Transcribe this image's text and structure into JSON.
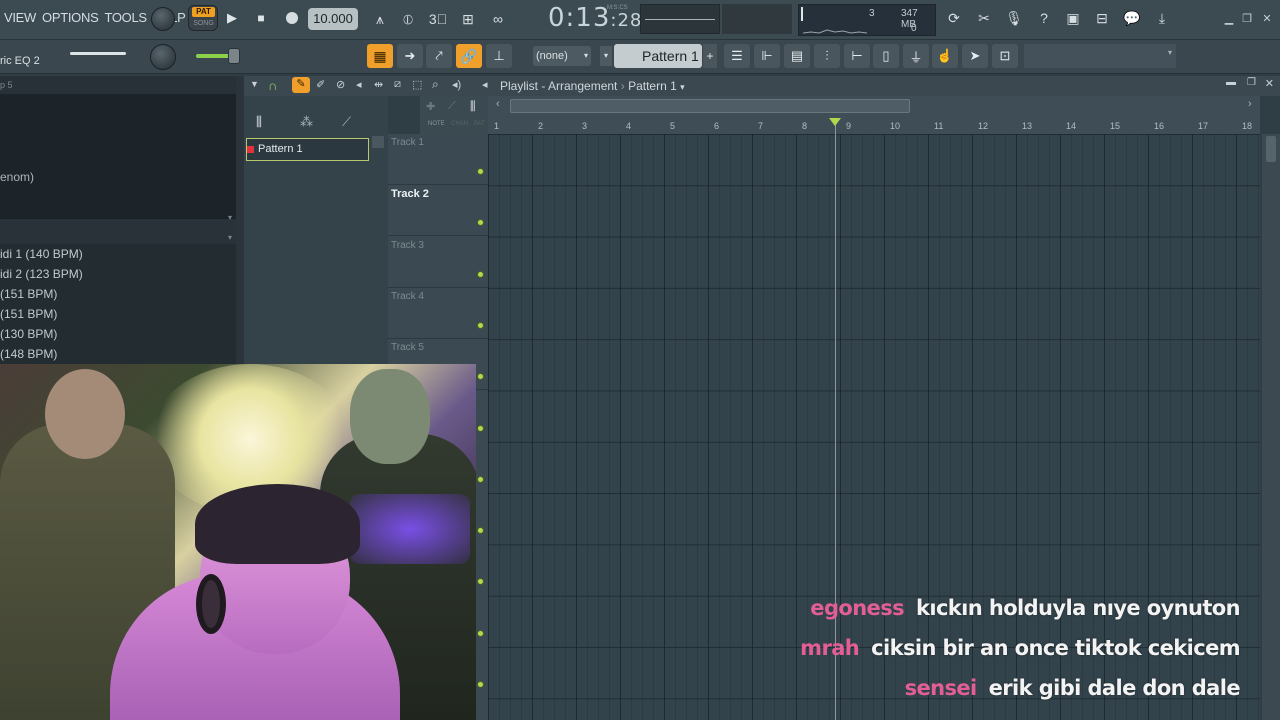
{
  "menu": {
    "items": [
      "VIEW",
      "OPTIONS",
      "TOOLS",
      "HELP"
    ]
  },
  "transport": {
    "pat_label": "PAT",
    "song_label": "SONG",
    "tempo": "10.000",
    "time_main": "0:13",
    "time_sub": ":28",
    "time_units": "M:S:CS",
    "cpu_value": "3",
    "memory": "347 MB",
    "poly": "0"
  },
  "channel": {
    "preset_name": "ric EQ 2",
    "none_select": "(none)",
    "pattern_select": "Pattern 1",
    "plus_label": "+"
  },
  "browser": {
    "header": "p 5",
    "partial_label": "enom)",
    "items": [
      "idi 1 (140 BPM)",
      "idi 2 (123 BPM)",
      "(151 BPM)",
      "(151 BPM)",
      "(130 BPM)",
      "(148 BPM)"
    ]
  },
  "playlist": {
    "title": "Playlist - Arrangement",
    "pattern_crumb": "Pattern 1",
    "pattern_item": "Pattern 1",
    "tracks": [
      "Track 1",
      "Track 2",
      "Track 3",
      "Track 4",
      "Track 5"
    ],
    "active_track": "Track 2",
    "ruler": [
      "1",
      "2",
      "3",
      "4",
      "5",
      "6",
      "7",
      "8",
      "9",
      "10",
      "11",
      "12",
      "13",
      "14",
      "15",
      "16",
      "17",
      "18"
    ],
    "col_labels": [
      "NOTE",
      "CHAN",
      "PAT"
    ],
    "playhead_position": 8.75
  },
  "chat": [
    {
      "user": "egoness",
      "message": "kıckın holduyla nıye oynuton"
    },
    {
      "user": "mrah",
      "message": "ciksin bir an once tiktok cekicem"
    },
    {
      "user": "sensei",
      "message": "erik gibi dale don dale"
    }
  ],
  "colors": {
    "accent_orange": "#f0a02a",
    "chat_name": "#e35e94",
    "track_dot": "#b4d84c"
  }
}
